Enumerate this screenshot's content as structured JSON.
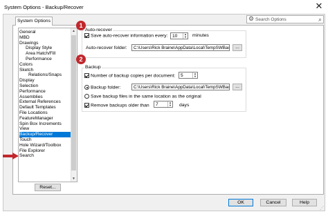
{
  "window": {
    "title": "System Options - Backup/Recover",
    "close_glyph": "✕"
  },
  "tabs": [
    {
      "label": "System Options"
    }
  ],
  "search": {
    "placeholder": "Search Options"
  },
  "tree": {
    "selected": "Backup/Recover",
    "items": [
      {
        "label": "General",
        "level": 0
      },
      {
        "label": "MBD",
        "level": 0
      },
      {
        "label": "Drawings",
        "level": 0
      },
      {
        "label": "Display Style",
        "level": 1
      },
      {
        "label": "Area Hatch/Fill",
        "level": 1
      },
      {
        "label": "Performance",
        "level": 1
      },
      {
        "label": "Colors",
        "level": 0
      },
      {
        "label": "Sketch",
        "level": 0
      },
      {
        "label": "Relations/Snaps",
        "level": 2
      },
      {
        "label": "Display",
        "level": 0
      },
      {
        "label": "Selection",
        "level": 0
      },
      {
        "label": "Performance",
        "level": 0
      },
      {
        "label": "Assemblies",
        "level": 0
      },
      {
        "label": "External References",
        "level": 0
      },
      {
        "label": "Default Templates",
        "level": 0
      },
      {
        "label": "File Locations",
        "level": 0
      },
      {
        "label": "FeatureManager",
        "level": 0
      },
      {
        "label": "Spin Box Increments",
        "level": 0
      },
      {
        "label": "View",
        "level": 0
      },
      {
        "label": "Backup/Recover",
        "level": 0
      },
      {
        "label": "Touch",
        "level": 0
      },
      {
        "label": "Hole Wizard/Toolbox",
        "level": 0
      },
      {
        "label": "File Explorer",
        "level": 0
      },
      {
        "label": "Search",
        "level": 0
      }
    ]
  },
  "reset_label": "Reset...",
  "autorecover": {
    "badge": "1",
    "group_title": "Auto-recover",
    "save_label": "Save auto-recover information every:",
    "save_checked": true,
    "interval_value": "10",
    "interval_unit": "minutes",
    "folder_label": "Auto-recover folder:",
    "folder_value": "C:\\Users\\Rick Braine\\AppData\\Local\\TempSWBacku",
    "browse_label": "..."
  },
  "backup": {
    "badge": "2",
    "group_title": "Backup",
    "copies_label": "Number of backup copies per document:",
    "copies_checked": true,
    "copies_value": "5",
    "folder_radio_label": "Backup folder:",
    "folder_radio_checked": true,
    "folder_value": "C:\\Users\\Rick Braine\\AppData\\Local\\TempSWBacku",
    "browse_label": "...",
    "same_location_label": "Save backup files in the same location as the original",
    "remove_label": "Remove backups older than",
    "remove_checked": true,
    "remove_value": "7",
    "remove_unit": "days"
  },
  "footer": {
    "ok": "OK",
    "cancel": "Cancel",
    "help": "Help"
  },
  "colors": {
    "accent": "#0078d7",
    "badge": "#c0282d",
    "arrow": "#c0282d"
  }
}
